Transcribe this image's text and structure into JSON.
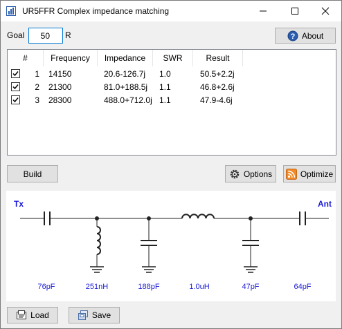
{
  "window": {
    "title": "UR5FFR Complex impedance matching"
  },
  "goal": {
    "label": "Goal",
    "value": "50",
    "unit": "R"
  },
  "buttons": {
    "about": "About",
    "build": "Build",
    "options": "Options",
    "optimize": "Optimize",
    "load": "Load",
    "save": "Save"
  },
  "table": {
    "columns": [
      "#",
      "Frequency",
      "Impedance",
      "SWR",
      "Result"
    ],
    "rows": [
      {
        "checked": true,
        "num": "1",
        "frequency": "14150",
        "impedance": "20.6-126.7j",
        "swr": "1.0",
        "result": "50.5+2.2j"
      },
      {
        "checked": true,
        "num": "2",
        "frequency": "21300",
        "impedance": "81.0+188.5j",
        "swr": "1.1",
        "result": "46.8+2.6j"
      },
      {
        "checked": true,
        "num": "3",
        "frequency": "28300",
        "impedance": "488.0+712.0j",
        "swr": "1.1",
        "result": "47.9-4.6j"
      }
    ]
  },
  "circuit": {
    "tx": "Tx",
    "ant": "Ant",
    "components": [
      "76pF",
      "251nH",
      "188pF",
      "1.0uH",
      "47pF",
      "64pF"
    ]
  },
  "colors": {
    "value_text": "#1a1ad6",
    "accent": "#0078d7"
  }
}
